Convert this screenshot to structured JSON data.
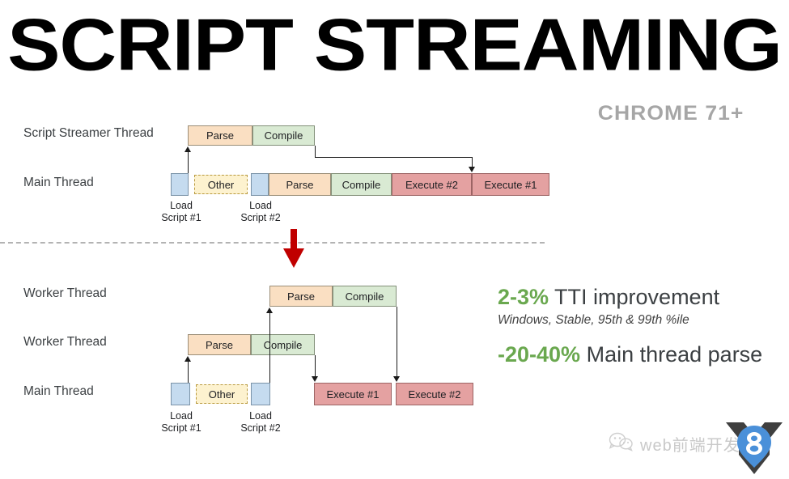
{
  "header": {
    "title": "SCRIPT STREAMING",
    "subtitle": "CHROME 71+"
  },
  "top_diagram": {
    "rows": [
      {
        "label": "Script Streamer Thread"
      },
      {
        "label": "Main Thread"
      }
    ],
    "streamer_blocks": [
      {
        "label": "Parse",
        "kind": "parse"
      },
      {
        "label": "Compile",
        "kind": "compile"
      }
    ],
    "main_blocks": [
      {
        "label": "",
        "kind": "load"
      },
      {
        "label": "Other",
        "kind": "other"
      },
      {
        "label": "",
        "kind": "load"
      },
      {
        "label": "Parse",
        "kind": "parse"
      },
      {
        "label": "Compile",
        "kind": "compile"
      },
      {
        "label": "Execute #2",
        "kind": "exec"
      },
      {
        "label": "Execute #1",
        "kind": "exec"
      }
    ],
    "captions": [
      {
        "line1": "Load",
        "line2": "Script #1"
      },
      {
        "line1": "Load",
        "line2": "Script #2"
      }
    ]
  },
  "bottom_diagram": {
    "rows": [
      {
        "label": "Worker Thread"
      },
      {
        "label": "Worker Thread"
      },
      {
        "label": "Main Thread"
      }
    ],
    "worker2_blocks": [
      {
        "label": "Parse",
        "kind": "parse"
      },
      {
        "label": "Compile",
        "kind": "compile"
      }
    ],
    "worker1_blocks": [
      {
        "label": "Parse",
        "kind": "parse"
      },
      {
        "label": "Compile",
        "kind": "compile"
      }
    ],
    "main_blocks": [
      {
        "label": "",
        "kind": "load"
      },
      {
        "label": "Other",
        "kind": "other"
      },
      {
        "label": "",
        "kind": "load"
      },
      {
        "label": "Execute #1",
        "kind": "exec"
      },
      {
        "label": "Execute #2",
        "kind": "exec"
      }
    ],
    "captions": [
      {
        "line1": "Load",
        "line2": "Script #1"
      },
      {
        "line1": "Load",
        "line2": "Script #2"
      }
    ]
  },
  "stats": {
    "tti_pct": "2-3%",
    "tti_label": "TTI improvement",
    "tti_sub": "Windows, Stable, 95th & 99th %ile",
    "parse_pct": "-20-40%",
    "parse_label": "Main thread parse",
    "accent_green": "#6aa84f"
  },
  "watermark": {
    "text": "web前端开发"
  },
  "colors": {
    "parse": "#fadfc2",
    "compile": "#d9ead3",
    "execute": "#e4a1a1",
    "load": "#c5dbef",
    "other": "#fdf2cf",
    "red_arrow": "#c00000",
    "subtitle_gray": "#a6a6a6"
  }
}
